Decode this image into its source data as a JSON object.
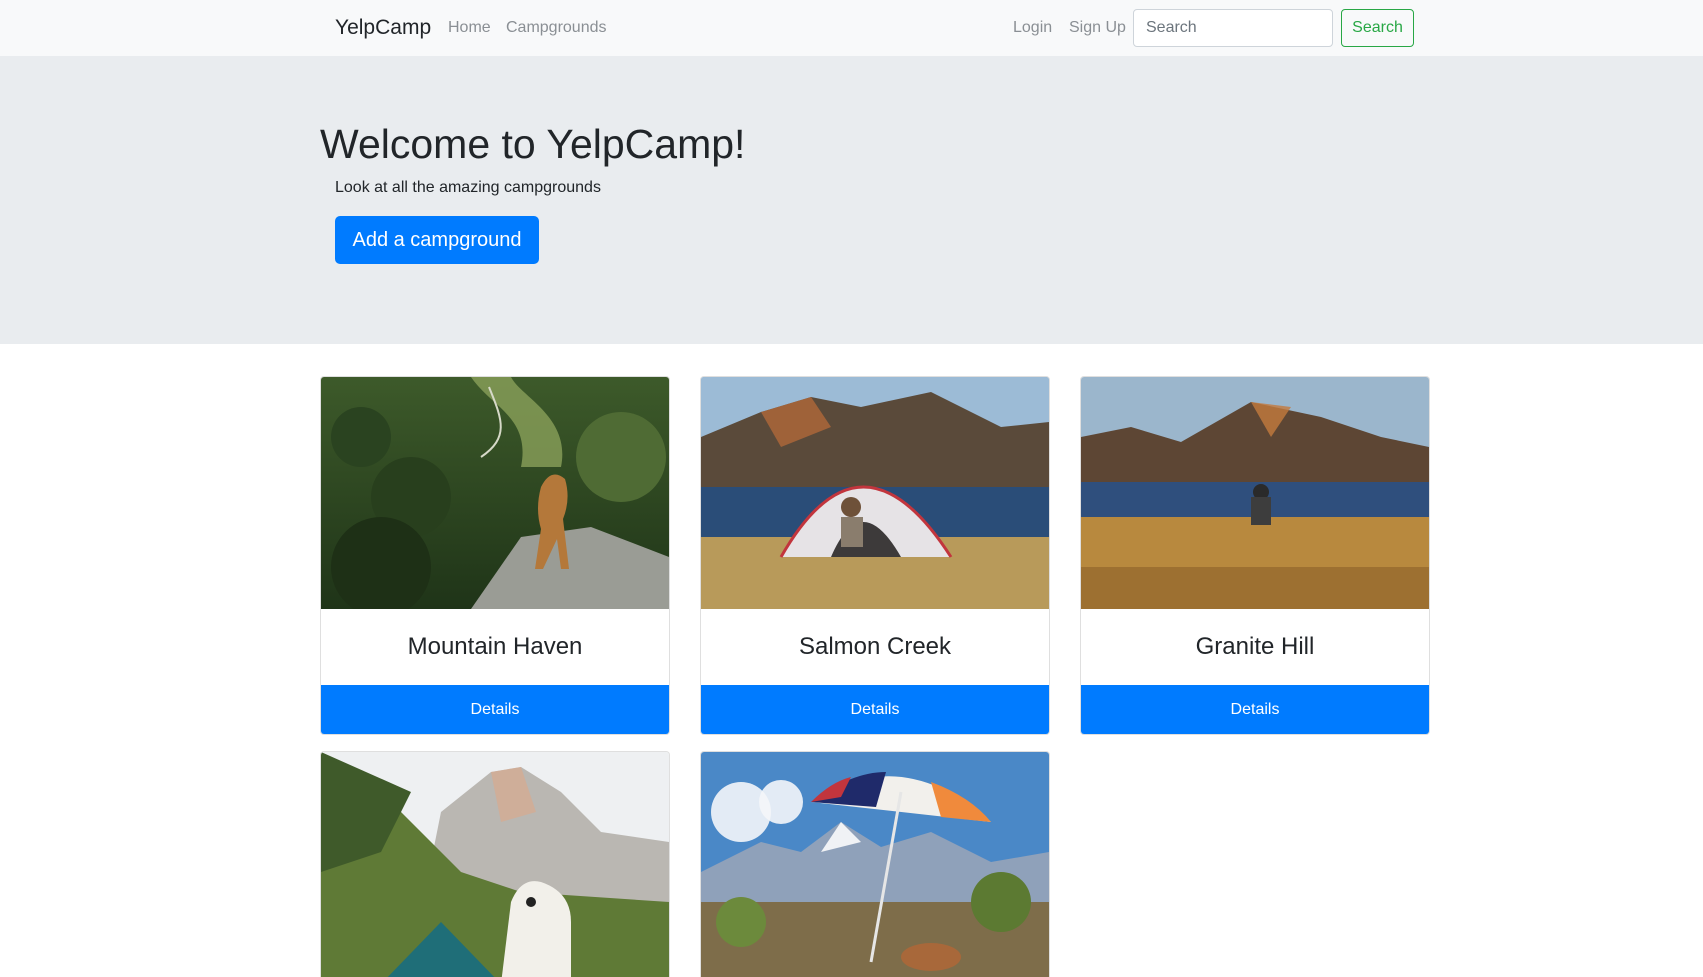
{
  "navbar": {
    "brand": "YelpCamp",
    "links": [
      {
        "label": "Home"
      },
      {
        "label": "Campgrounds"
      }
    ],
    "login_label": "Login",
    "signup_label": "Sign Up",
    "search_placeholder": "Search",
    "search_button": "Search"
  },
  "jumbotron": {
    "title": "Welcome to YelpCamp!",
    "lead": "Look at all the amazing campgrounds",
    "button_label": "Add a campground"
  },
  "campgrounds": [
    {
      "name": "Mountain Haven",
      "button": "Details",
      "image": "dog-on-rock-forest"
    },
    {
      "name": "Salmon Creek",
      "button": "Details",
      "image": "tent-by-lake"
    },
    {
      "name": "Granite Hill",
      "button": "Details",
      "image": "dog-by-lake"
    },
    {
      "name": "",
      "button": "",
      "image": "dog-with-tent-mountains"
    },
    {
      "name": "",
      "button": "",
      "image": "umbrella-mountains"
    }
  ],
  "colors": {
    "primary": "#007bff",
    "success": "#28a745",
    "navbar_bg": "#f8f9fa",
    "jumbotron_bg": "#e9ecef"
  }
}
